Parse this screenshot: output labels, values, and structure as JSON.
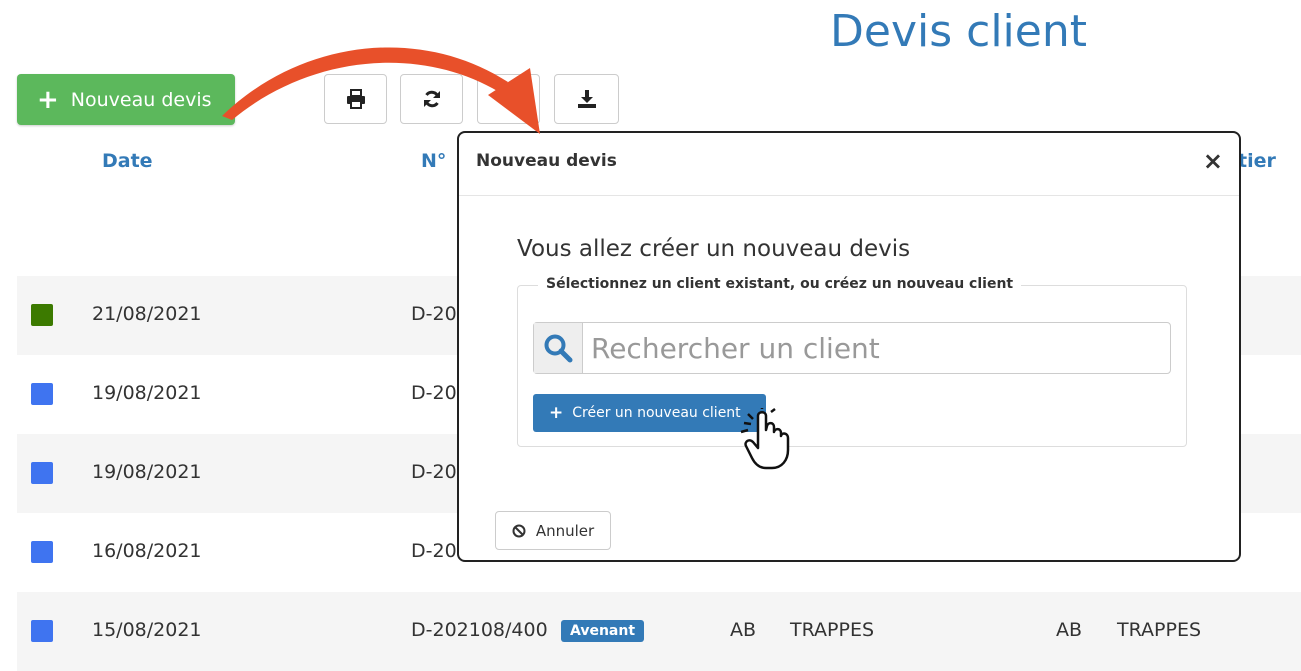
{
  "header": {
    "title": "Devis client",
    "new_button": "Nouveau devis"
  },
  "toolbar": {
    "icons": [
      "print-icon",
      "refresh-icon",
      "blank",
      "download-icon"
    ]
  },
  "table": {
    "columns": [
      "Date",
      "N°",
      "tier"
    ],
    "rows": [
      {
        "color": "#3c7a00",
        "date": "21/08/2021",
        "num": "D-20"
      },
      {
        "color": "#3f74f0",
        "date": "19/08/2021",
        "num": "D-20"
      },
      {
        "color": "#3f74f0",
        "date": "19/08/2021",
        "num": "D-20"
      },
      {
        "color": "#3f74f0",
        "date": "16/08/2021",
        "num": "D-20"
      },
      {
        "color": "#3f74f0",
        "date": "15/08/2021",
        "num": "D-202108/400",
        "badge": "Avenant",
        "c1": "AB",
        "c2": "TRAPPES",
        "c3": "AB",
        "c4": "TRAPPES"
      }
    ]
  },
  "modal": {
    "title": "Nouveau devis",
    "close": "×",
    "intro": "Vous allez créer un nouveau devis",
    "legend": "Sélectionnez un client existant, ou créez un nouveau client",
    "search_placeholder": "Rechercher un client",
    "create_button": "Créer un nouveau client",
    "cancel_button": "Annuler"
  },
  "colors": {
    "accent": "#337ab7",
    "success": "#5cb85c",
    "annotation_arrow": "#e8502a"
  }
}
